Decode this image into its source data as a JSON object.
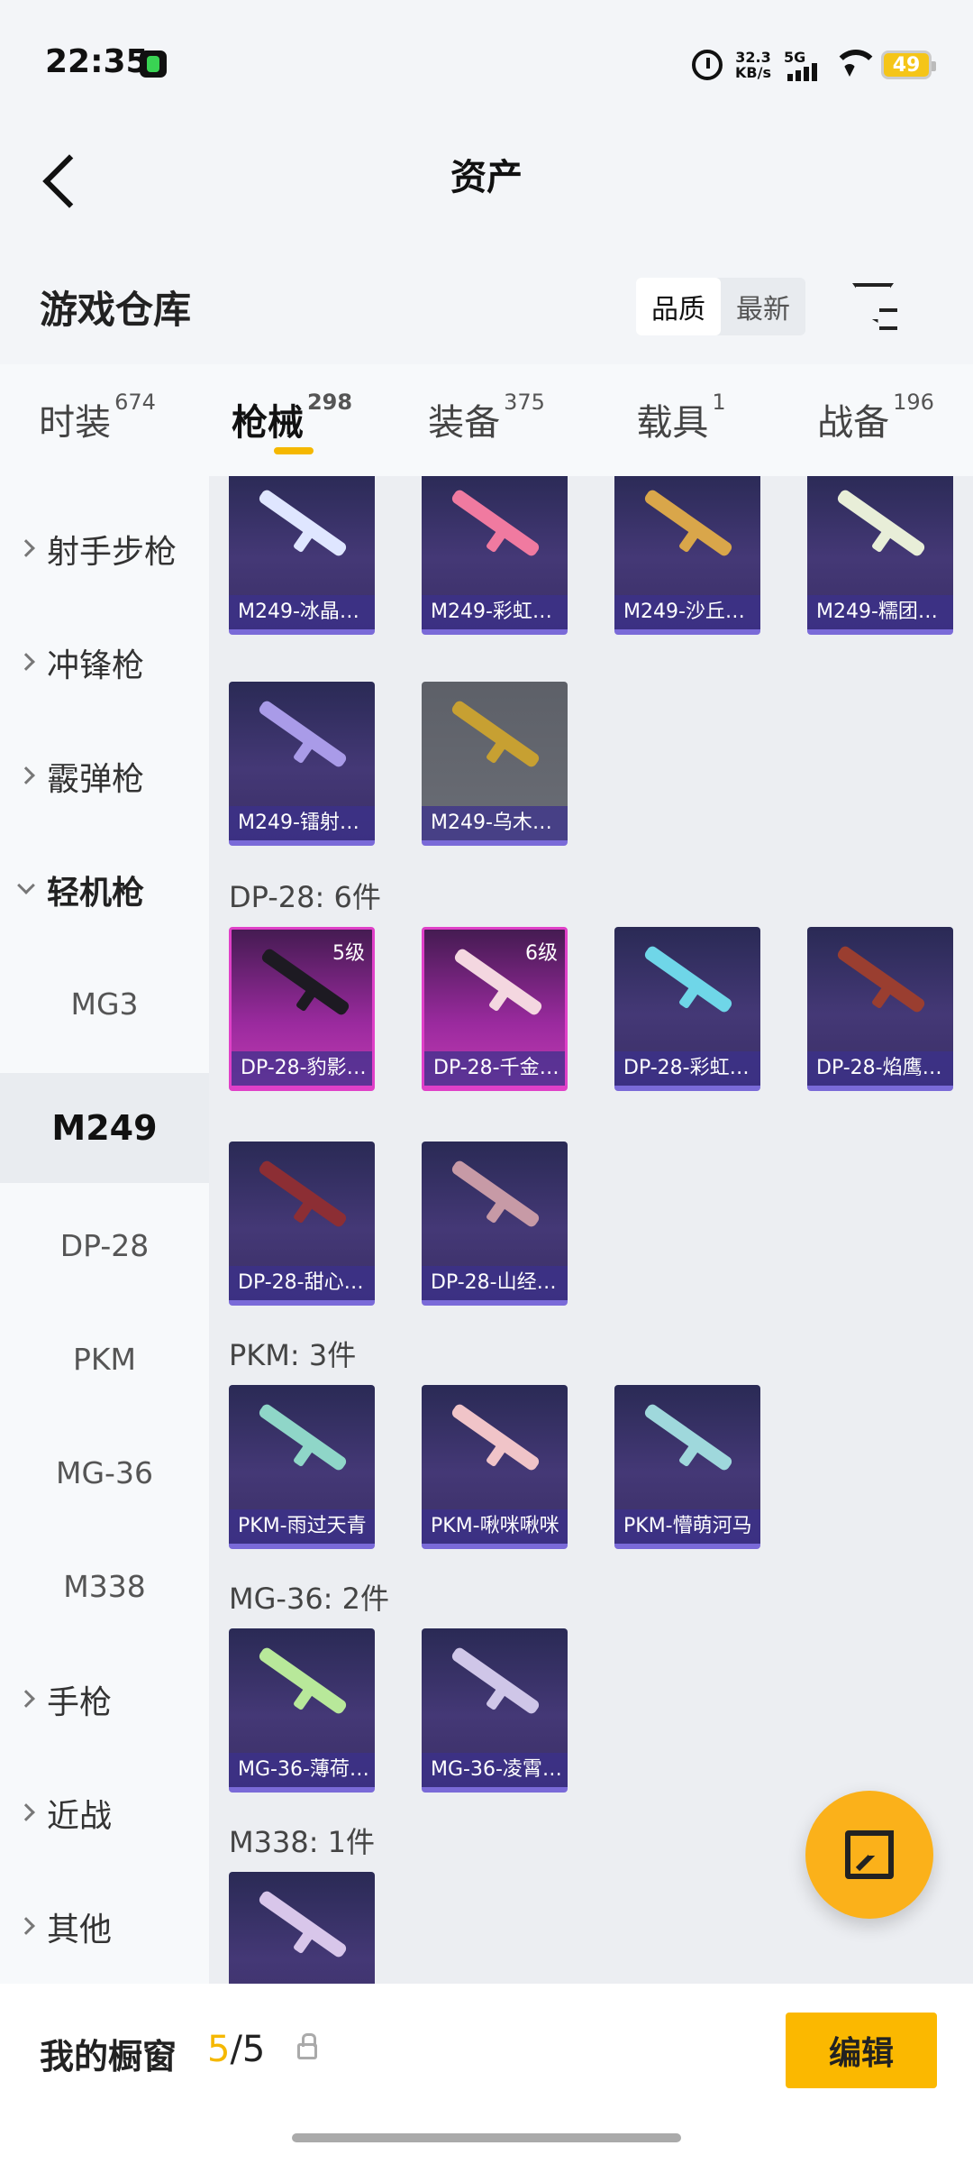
{
  "status_bar": {
    "time": "22:35",
    "net_speed_value": "32.3",
    "net_speed_unit": "KB/s",
    "network": "5G",
    "battery": "49"
  },
  "header": {
    "title": "资产"
  },
  "warehouse": {
    "title": "游戏仓库",
    "sort_quality": "品质",
    "sort_newest": "最新"
  },
  "tabs": [
    {
      "label": "时装",
      "count": "674"
    },
    {
      "label": "枪械",
      "count": "298"
    },
    {
      "label": "装备",
      "count": "375"
    },
    {
      "label": "载具",
      "count": "1"
    },
    {
      "label": "战备",
      "count": "196"
    }
  ],
  "sidebar": [
    "射手步枪",
    "冲锋枪",
    "霰弹枪",
    "轻机枪",
    "MG3",
    "M249",
    "DP-28",
    "PKM",
    "MG-36",
    "M338",
    "手枪",
    "近战",
    "其他"
  ],
  "groups": {
    "dp28": "DP-28: 6件",
    "pkm": "PKM: 3件",
    "mg36": "MG-36: 2件",
    "m338": "M338: 1件"
  },
  "cards": [
    {
      "name": "M249-冰晶…",
      "level": ""
    },
    {
      "name": "M249-彩虹…",
      "level": ""
    },
    {
      "name": "M249-沙丘…",
      "level": ""
    },
    {
      "name": "M249-糯团…",
      "level": ""
    },
    {
      "name": "M249-镭射…",
      "level": ""
    },
    {
      "name": "M249-乌木…",
      "level": ""
    },
    {
      "name": "DP-28-豹影…",
      "level": "5级"
    },
    {
      "name": "DP-28-千金…",
      "level": "6级"
    },
    {
      "name": "DP-28-彩虹…",
      "level": ""
    },
    {
      "name": "DP-28-焰鹰…",
      "level": ""
    },
    {
      "name": "DP-28-甜心…",
      "level": ""
    },
    {
      "name": "DP-28-山经…",
      "level": ""
    },
    {
      "name": "PKM-雨过天青",
      "level": ""
    },
    {
      "name": "PKM-啾咪啾咪",
      "level": ""
    },
    {
      "name": "PKM-懵萌河马",
      "level": ""
    },
    {
      "name": "MG-36-薄荷…",
      "level": ""
    },
    {
      "name": "MG-36-凌霄…",
      "level": ""
    }
  ],
  "bottom": {
    "label": "我的橱窗",
    "count_current": "5",
    "count_total": "/5",
    "edit": "编辑"
  }
}
